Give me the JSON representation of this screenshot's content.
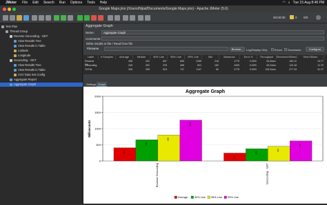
{
  "menubar": {
    "app_name": "JMeter",
    "menus": [
      "File",
      "Edit",
      "Search",
      "Run",
      "Options",
      "Tools",
      "Help"
    ],
    "clock": "Tue 15 Aug  8:46 PM"
  },
  "window": {
    "title": "Google Maps.jmx (/Users/Nipul/Documents/Google Maps.jmx) - Apache JMeter (5.6)"
  },
  "toolbar": {
    "timer": "00:00:00",
    "warnings": "0",
    "threads": "0/0"
  },
  "tree": {
    "items": [
      {
        "label": "Test Plan",
        "color": "#9aa3ad"
      },
      {
        "label": "Thread Group",
        "color": "#9aa3ad"
      },
      {
        "label": "Reverse Geocoding - GET",
        "color": "#c9c9c9"
      },
      {
        "label": "View Results Tree",
        "color": "#5a9bd5"
      },
      {
        "label": "View Results in Table",
        "color": "#5a9bd5"
      },
      {
        "label": "Latitude",
        "color": "#c9a94d"
      },
      {
        "label": "Longitude",
        "color": "#c9a94d"
      },
      {
        "label": "Geocoding - GET",
        "color": "#c9c9c9"
      },
      {
        "label": "View Results Tree",
        "color": "#5a9bd5"
      },
      {
        "label": "View Results in Table",
        "color": "#5a9bd5"
      },
      {
        "label": "CSV Data Set Config",
        "color": "#c9a94d"
      },
      {
        "label": "Aggregate Report",
        "color": "#5a9bd5"
      },
      {
        "label": "Aggregate Graph",
        "color": "#5a9bd5"
      }
    ]
  },
  "panel": {
    "heading": "Aggregate Graph",
    "name_label": "Name:",
    "name_value": "Aggregate Graph",
    "comments_label": "Comments:",
    "write_results": "Write results to file / Read from file",
    "filename_label": "Filename",
    "browse": "Browse...",
    "log_display": "Log/Display Only:",
    "errors": "Errors",
    "successes": "Successes",
    "configure": "Configure"
  },
  "table": {
    "headers": [
      "Label",
      "# Samples",
      "Average",
      "Median",
      "90% Line",
      "95% Line",
      "99% Line",
      "Min",
      "Maximum",
      "Error %",
      "Throughput",
      "Received KB/sec",
      "Sent KB/sec"
    ],
    "rows": [
      [
        "Reverse Ge...",
        "",
        "408",
        "331",
        "657",
        "805",
        "1265",
        "218",
        "1775",
        "0.00%",
        "54.8/sec",
        "160.11",
        "19.77"
      ],
      [
        "Geocoding ...",
        "",
        "245",
        "251",
        "378",
        "456",
        "621",
        "162",
        "1005",
        "0.00%",
        "54.2/sec",
        "119.18",
        "11.70"
      ],
      [
        "TOTAL",
        "",
        "326",
        "250",
        "524",
        "747",
        "1147",
        "82",
        "1775",
        "0.00%",
        "106.3/sec",
        "277.33",
        "31.17"
      ]
    ]
  },
  "tabs": [
    "Settings",
    "Graph"
  ],
  "chart_data": {
    "type": "bar",
    "title": "Aggregate Graph",
    "ylabel": "Milliseconds",
    "ylim": [
      0,
      2000
    ],
    "yticks": [
      0,
      500,
      1000,
      1500,
      2000
    ],
    "categories": [
      "Reverse Geocoding",
      "Geocoding - GET"
    ],
    "series": [
      {
        "name": "Average",
        "color": "#e00000",
        "values": [
          408,
          245
        ]
      },
      {
        "name": "90% Line",
        "color": "#00a000",
        "values": [
          657,
          378
        ]
      },
      {
        "name": "95% Line",
        "color": "#e8e800",
        "values": [
          805,
          456
        ]
      },
      {
        "name": "99% Line",
        "color": "#e000e0",
        "values": [
          1265,
          621
        ]
      }
    ]
  }
}
